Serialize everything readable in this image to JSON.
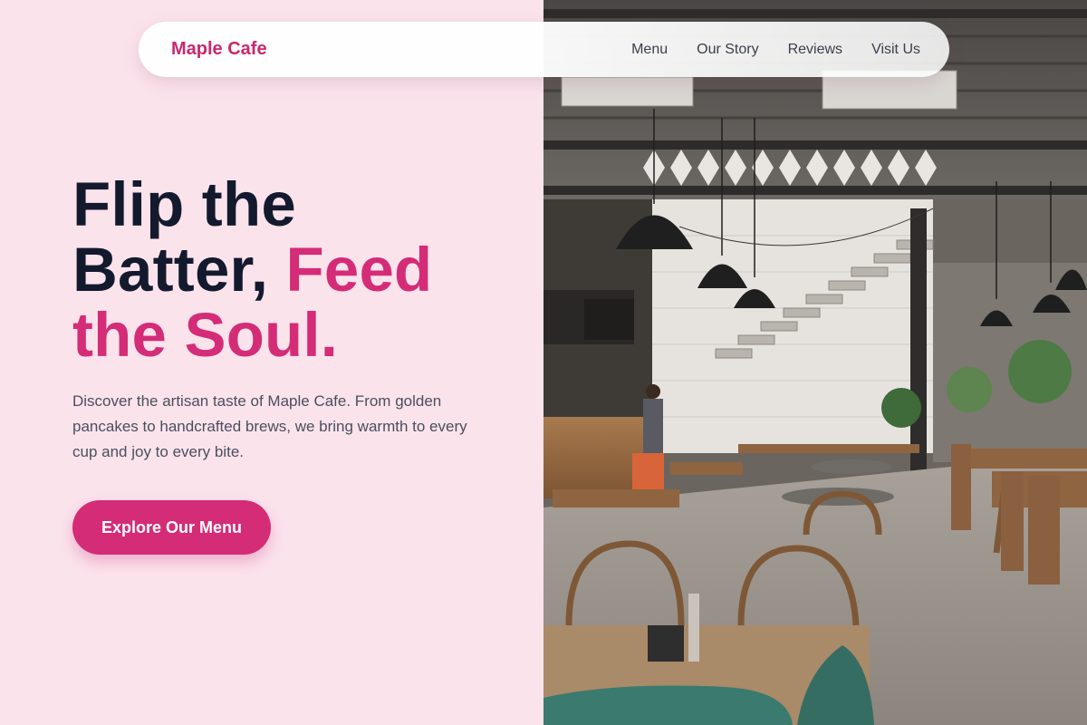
{
  "nav": {
    "brand": "Maple Cafe",
    "links": [
      "Menu",
      "Our Story",
      "Reviews",
      "Visit Us"
    ]
  },
  "hero": {
    "headline_part1": "Flip the Batter, ",
    "headline_accent": "Feed the Soul.",
    "description": "Discover the artisan taste of Maple Cafe. From golden pancakes to handcrafted brews, we bring warmth to every cup and joy to every bite.",
    "cta_label": "Explore Our Menu"
  },
  "colors": {
    "brand": "#c8286e",
    "accent": "#d42c76",
    "headline": "#141a2e",
    "background": "#fbe3ec"
  }
}
